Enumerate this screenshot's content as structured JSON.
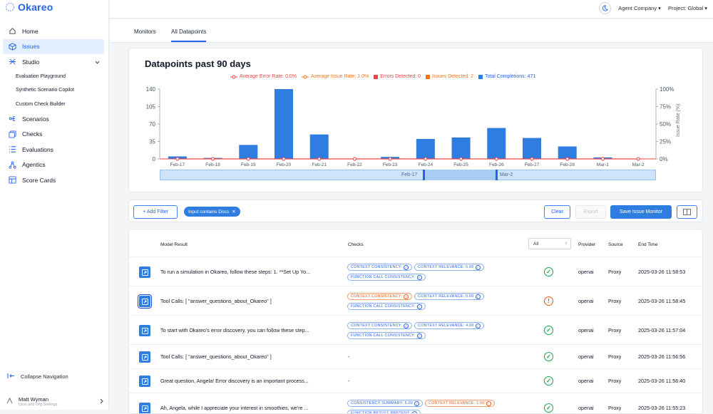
{
  "brand": {
    "name": "Okareo"
  },
  "header": {
    "company": "Agent Company",
    "project": "Project: Global"
  },
  "sidebar": {
    "items": [
      {
        "label": "Home",
        "icon": "home-icon"
      },
      {
        "label": "Issues",
        "icon": "cube-icon"
      },
      {
        "label": "Studio",
        "icon": "flask-icon"
      }
    ],
    "studio_sub": [
      "Evaluation Playground",
      "Synthetic Scenario Copilot",
      "Custom Check Builder"
    ],
    "items2": [
      {
        "label": "Scenarios",
        "icon": "scenario-icon"
      },
      {
        "label": "Checks",
        "icon": "checks-icon"
      },
      {
        "label": "Evaluations",
        "icon": "list-icon"
      },
      {
        "label": "Agentics",
        "icon": "agent-icon"
      },
      {
        "label": "Score Cards",
        "icon": "scorecard-icon"
      }
    ],
    "collapse": "Collapse Navigation",
    "user": {
      "name": "Matt Wyman",
      "sub": "User and Org Settings"
    }
  },
  "tabs": [
    "Monitors",
    "All Datapoints"
  ],
  "chart": {
    "title": "Datapoints past 90 days",
    "legend": [
      "Average Error Rate: 0.0%",
      "Average Issue Rate: 1.0%",
      "Errors Detected: 0",
      "Issues Detected: 2",
      "Total Completions: 471"
    ],
    "right_axis_label": "Issue Rate (%)",
    "range_start": "Feb-17",
    "range_end": "Mar-2"
  },
  "chart_data": {
    "type": "bar",
    "categories": [
      "Feb-17",
      "Feb-18",
      "Feb-19",
      "Feb-20",
      "Feb-21",
      "Feb-22",
      "Feb-23",
      "Feb-24",
      "Feb-25",
      "Feb-26",
      "Feb-27",
      "Feb-28",
      "Mar-1",
      "Mar-2"
    ],
    "series": [
      {
        "name": "Total Completions",
        "values": [
          5,
          2,
          28,
          140,
          49,
          0,
          4,
          40,
          43,
          62,
          42,
          25,
          3,
          0
        ],
        "color": "#2f7de1"
      },
      {
        "name": "Average Issue Rate",
        "values": [
          0,
          0,
          0,
          0,
          0,
          0,
          0,
          0,
          0,
          0,
          0,
          0,
          0,
          0
        ],
        "color": "#ef4444"
      }
    ],
    "yticks": [
      "0",
      "35",
      "70",
      "105",
      "140"
    ],
    "y2ticks": [
      "0%",
      "25%",
      "50%",
      "75%",
      "100%"
    ],
    "ylim": [
      0,
      140
    ],
    "y2lim": [
      0,
      100
    ]
  },
  "filters": {
    "add_filter": "+ Add Filter",
    "chip": "Input contains Docs",
    "clear": "Clear",
    "export": "Export",
    "save": "Save Issue Monitor"
  },
  "table": {
    "headers": {
      "model_result": "Model Result",
      "checks": "Checks",
      "filter": "All",
      "provider": "Provider",
      "source": "Source",
      "end_time": "End Time"
    },
    "rows": [
      {
        "result": "To run a simulation in Okareo, follow these steps: 1. **Set Up Yo...",
        "checks": [
          {
            "t": "CONTEXT CONSISTENCY:",
            "w": false
          },
          {
            "t": "CONTEXT RELEVANCE: 5.00",
            "w": false
          },
          {
            "t": "FUNCTION CALL CONSISTENCY:",
            "w": false
          }
        ],
        "status": "ok",
        "provider": "openai",
        "source": "Proxy",
        "time": "2025-03-26 11:58:53"
      },
      {
        "result": "Tool Calls: [ \"answer_questions_about_Okareo\" ]",
        "checks": [
          {
            "t": "CONTEXT CONSISTENCY:",
            "w": true
          },
          {
            "t": "CONTEXT RELEVANCE: 5.00",
            "w": false
          },
          {
            "t": "FUNCTION CALL CONSISTENCY:",
            "w": false
          }
        ],
        "status": "bad",
        "provider": "openai",
        "source": "Proxy",
        "time": "2025-03-26 11:58:45",
        "selected": true
      },
      {
        "result": "To start with Okareo's error discovery, you can follow these step...",
        "checks": [
          {
            "t": "CONTEXT CONSISTENCY:",
            "w": false
          },
          {
            "t": "CONTEXT RELEVANCE: 4.00",
            "w": false
          },
          {
            "t": "FUNCTION CALL CONSISTENCY:",
            "w": false
          }
        ],
        "status": "ok",
        "provider": "openai",
        "source": "Proxy",
        "time": "2025-03-26 11:57:04"
      },
      {
        "result": "Tool Calls: [ \"answer_questions_about_Okareo\" ]",
        "checks": [],
        "dash": "-",
        "status": "ok",
        "provider": "openai",
        "source": "Proxy",
        "time": "2025-03-26 11:56:56"
      },
      {
        "result": "Great question, Angela! Error discovery is an important process...",
        "checks": [],
        "dash": "-",
        "status": "ok",
        "provider": "openai",
        "source": "Proxy",
        "time": "2025-03-26 11:56:40"
      },
      {
        "result": "Ah, Angela, while I appreciate your interest in smoothies, we're ...",
        "checks": [
          {
            "t": "CONSISTENCY SUMMARY: 5.00",
            "w": false
          },
          {
            "t": "CONTEXT RELEVANCE: 1.00",
            "w": true
          },
          {
            "t": "FUNCTION RESULT PRESENT:",
            "w": false
          }
        ],
        "status": "ok",
        "provider": "openai",
        "source": "Proxy",
        "time": "2025-03-26 11:55:23"
      }
    ]
  }
}
